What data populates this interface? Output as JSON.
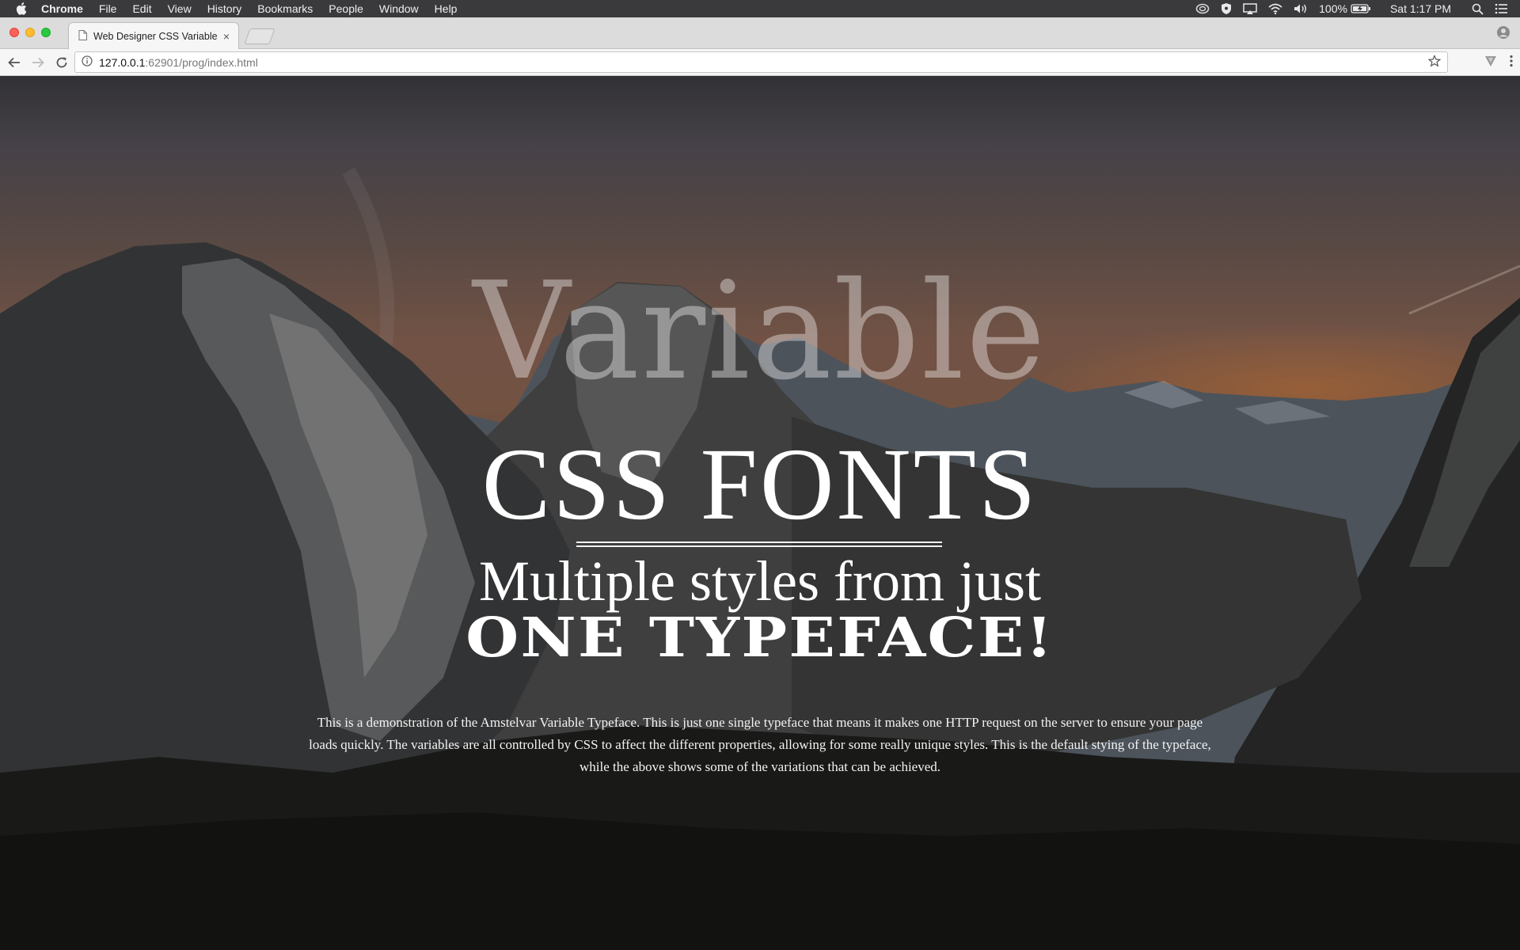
{
  "menubar": {
    "app": "Chrome",
    "items": [
      "File",
      "Edit",
      "View",
      "History",
      "Bookmarks",
      "People",
      "Window",
      "Help"
    ],
    "battery": "100%",
    "clock": "Sat 1:17 PM"
  },
  "browser": {
    "tab_title": "Web Designer CSS Variable Fo",
    "url_host": "127.0.0.1",
    "url_path": ":62901/prog/index.html"
  },
  "page": {
    "word_variable": "Variable",
    "title_css_fonts": "CSS FONTS",
    "subtitle": "Multiple styles from just",
    "subtitle_strong": "ONE TYPEFACE!",
    "description": "This is a demonstration of the Amstelvar Variable Typeface. This is just one single typeface that means it makes one HTTP request on the server to ensure your page loads quickly. The variables are all controlled by CSS to affect the different properties, allowing for some really unique styles. This is the default stying of the typeface, while the above shows some of the variations that can be achieved."
  },
  "icons": {
    "menubar": [
      "apple-icon",
      "creative-cloud-icon",
      "shield-icon",
      "airplay-icon",
      "wifi-icon",
      "volume-icon",
      "battery-icon",
      "spotlight-search-icon",
      "notification-center-icon"
    ],
    "toolbar": [
      "back-arrow-icon",
      "forward-arrow-icon",
      "reload-icon",
      "info-icon",
      "bookmark-star-icon",
      "extension-icon",
      "chrome-menu-icon",
      "profile-icon"
    ]
  },
  "colors": {
    "menubar_bg": "#3a3a3c",
    "sky_warm": "#8d6450",
    "text": "#ffffff"
  }
}
